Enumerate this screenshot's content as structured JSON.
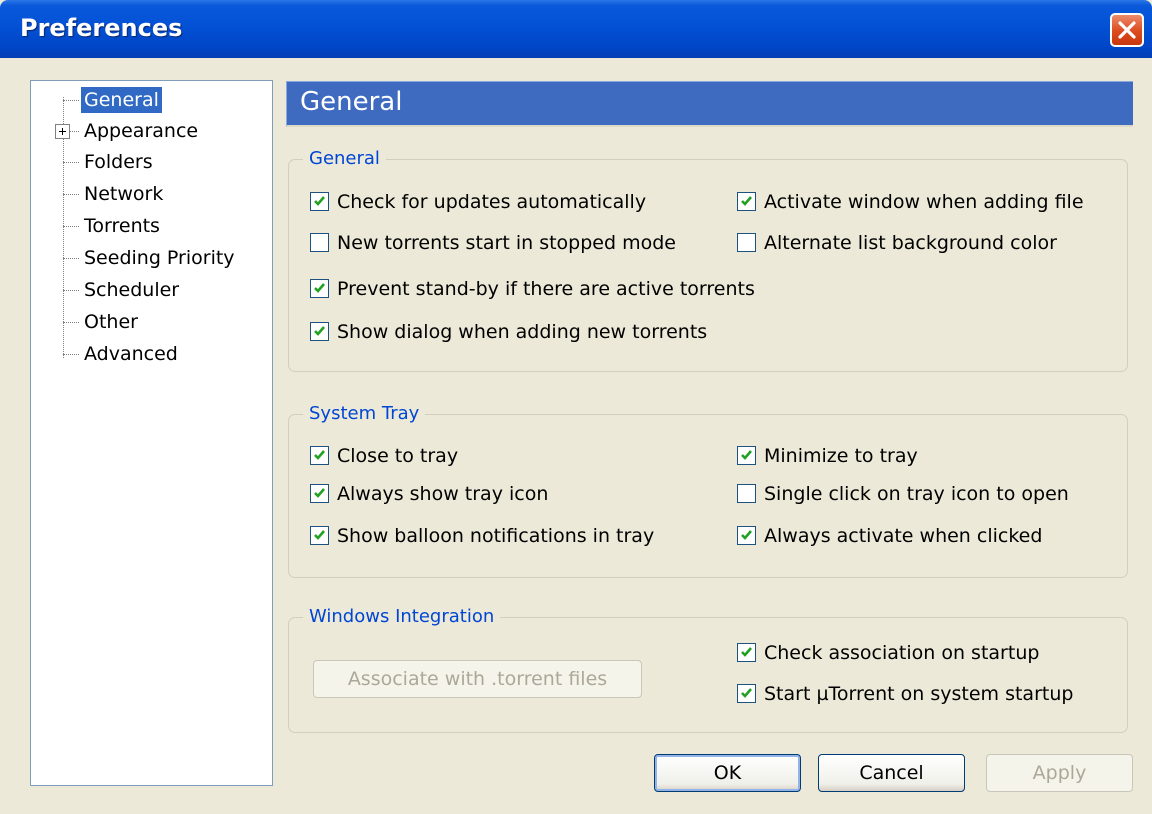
{
  "window": {
    "title": "Preferences"
  },
  "tree": {
    "items": [
      {
        "label": "General",
        "selected": true
      },
      {
        "label": "Appearance",
        "expandable": true
      },
      {
        "label": "Folders"
      },
      {
        "label": "Network"
      },
      {
        "label": "Torrents"
      },
      {
        "label": "Seeding Priority"
      },
      {
        "label": "Scheduler"
      },
      {
        "label": "Other"
      },
      {
        "label": "Advanced"
      }
    ]
  },
  "page_header": "General",
  "groups": {
    "general": {
      "title": "General",
      "options": [
        {
          "label": "Check for updates automatically",
          "checked": true
        },
        {
          "label": "Activate window when adding file",
          "checked": true
        },
        {
          "label": "New torrents start in stopped mode",
          "checked": false
        },
        {
          "label": "Alternate list background color",
          "checked": false
        },
        {
          "label": "Prevent stand-by if there are active torrents",
          "checked": true
        },
        {
          "label": "Show dialog when adding new torrents",
          "checked": true
        }
      ]
    },
    "tray": {
      "title": "System Tray",
      "options": [
        {
          "label": "Close to tray",
          "checked": true
        },
        {
          "label": "Minimize to tray",
          "checked": true
        },
        {
          "label": "Always show tray icon",
          "checked": true
        },
        {
          "label": "Single click on tray icon to open",
          "checked": false
        },
        {
          "label": "Show balloon notifications in tray",
          "checked": true
        },
        {
          "label": "Always activate when clicked",
          "checked": true
        }
      ]
    },
    "integration": {
      "title": "Windows Integration",
      "associate_button": "Associate with .torrent files",
      "options": [
        {
          "label": "Check association on startup",
          "checked": true
        },
        {
          "label": "Start µTorrent on system startup",
          "checked": true
        }
      ]
    }
  },
  "buttons": {
    "ok": "OK",
    "cancel": "Cancel",
    "apply": "Apply"
  },
  "colors": {
    "title_bar": "#0452d6",
    "selection": "#316ac5",
    "group_title": "#0046d5",
    "check_mark": "#21a121"
  }
}
